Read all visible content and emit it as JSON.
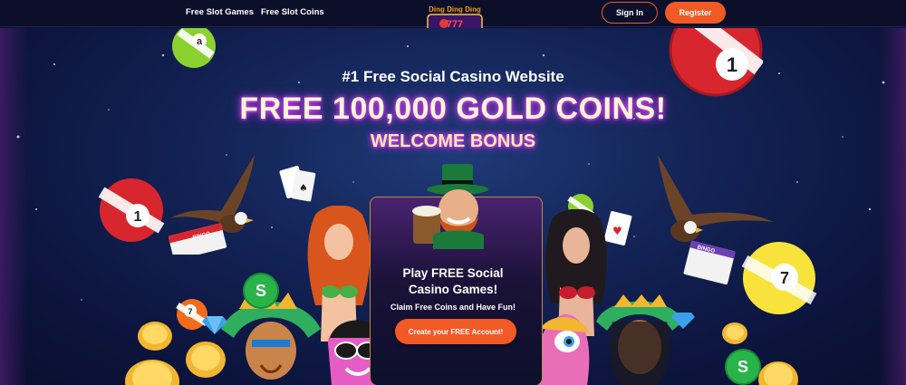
{
  "nav": {
    "links": [
      "Free Slot Games",
      "Free Slot Coins"
    ],
    "logo_text": "Ding Ding Ding",
    "signin_label": "Sign In",
    "register_label": "Register",
    "accent_color": "#f15a24"
  },
  "hero": {
    "subheading": "#1 Free Social Casino Website",
    "heading": "FREE 100,000 GOLD COINS!",
    "bonus": "WELCOME BONUS"
  },
  "promo": {
    "title_line1": "Play FREE Social",
    "title_line2": "Casino Games!",
    "subtitle": "Claim Free Coins and Have Fun!",
    "cta_label": "Create your FREE Account!"
  },
  "decor": {
    "bingo_ball_numbers": [
      "a",
      "1",
      "1",
      "7",
      "7"
    ],
    "card_labels": [
      "BINGO",
      "BINGO"
    ],
    "coin_symbol": "S"
  }
}
